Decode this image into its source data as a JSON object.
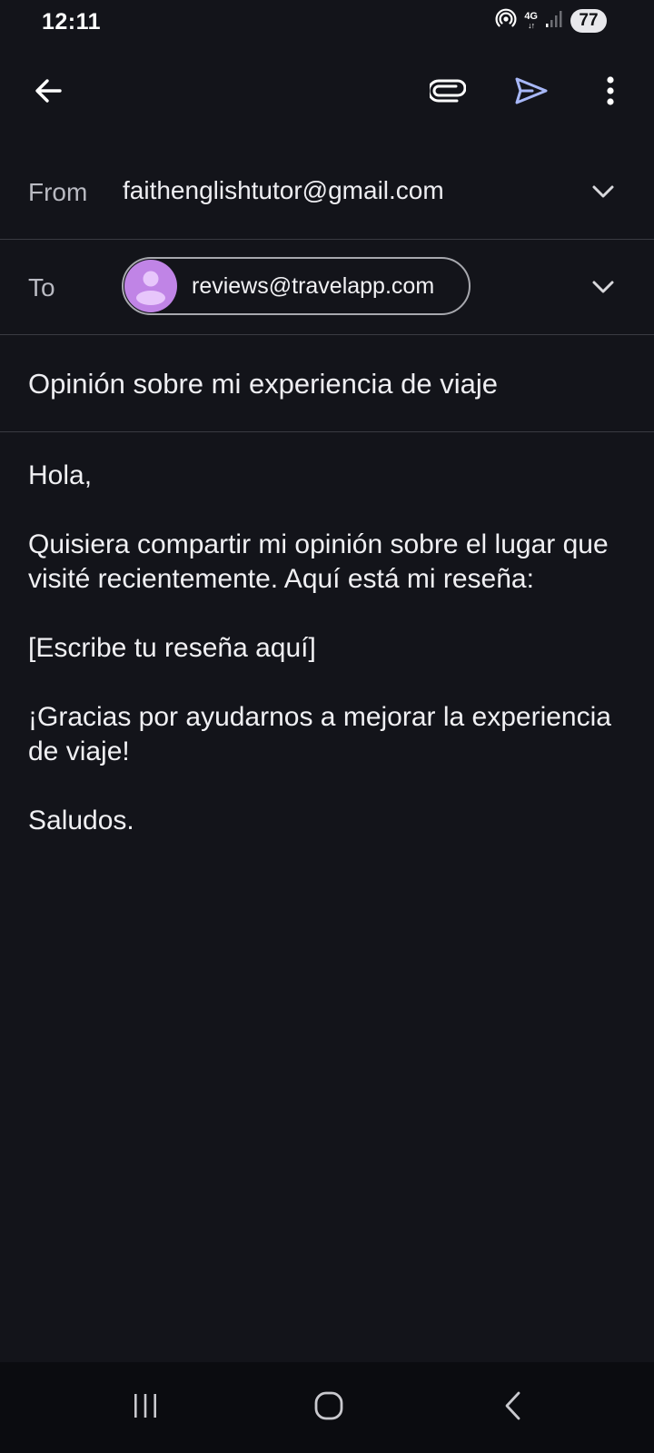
{
  "status_bar": {
    "time": "12:11",
    "network": "4G",
    "network_arrows": "↓↑",
    "battery": "77"
  },
  "toolbar": {
    "back_icon": "arrow-left-icon",
    "attach_icon": "paperclip-icon",
    "send_icon": "send-icon",
    "more_icon": "more-vert-icon",
    "send_color": "#a8b8f8"
  },
  "compose": {
    "from_label": "From",
    "from_value": "faithenglishtutor@gmail.com",
    "to_label": "To",
    "to_recipient": "reviews@travelapp.com",
    "avatar_color": "#c084e6",
    "subject": "Opinión sobre mi experiencia de viaje",
    "body": [
      "Hola,",
      "Quisiera compartir mi opinión sobre el lugar que visité recientemente. Aquí está mi reseña:",
      "[Escribe tu reseña aquí]",
      "¡Gracias por ayudarnos a mejorar la experiencia de viaje!",
      "Saludos."
    ]
  },
  "nav_bar": {
    "recents_icon": "recents-icon",
    "home_icon": "home-icon",
    "back_icon": "back-icon"
  }
}
